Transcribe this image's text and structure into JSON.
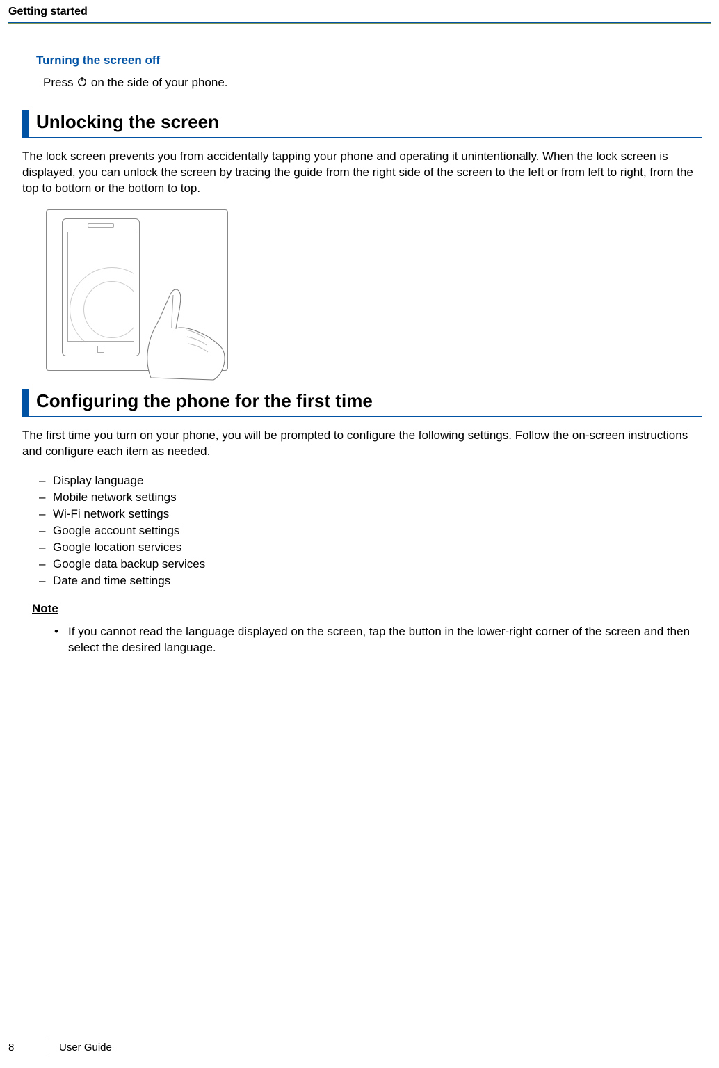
{
  "header": {
    "section": "Getting started"
  },
  "s1": {
    "heading": "Turning the screen off",
    "press_pre": "Press ",
    "press_post": " on the side of your phone."
  },
  "s2": {
    "heading": "Unlocking the screen",
    "body": "The lock screen prevents you from accidentally tapping your phone and operating it unintentionally. When the lock screen is displayed, you can unlock the screen by tracing the guide from the right side of the screen to the left or from left to right, from the top to bottom or the bottom to top."
  },
  "s3": {
    "heading": "Configuring the phone for the first time",
    "intro": "The first time you turn on your phone, you will be prompted to configure the following settings. Follow the on-screen instructions and configure each item as needed.",
    "items": [
      "Display language",
      "Mobile network settings",
      "Wi-Fi network settings",
      "Google account settings",
      "Google location services",
      "Google data backup services",
      "Date and time settings"
    ],
    "note_label": "Note",
    "note_bullets": [
      "If you cannot read the language displayed on the screen, tap the button in the lower-right corner of the screen and then select the desired language."
    ]
  },
  "footer": {
    "page": "8",
    "doc": "User Guide"
  }
}
